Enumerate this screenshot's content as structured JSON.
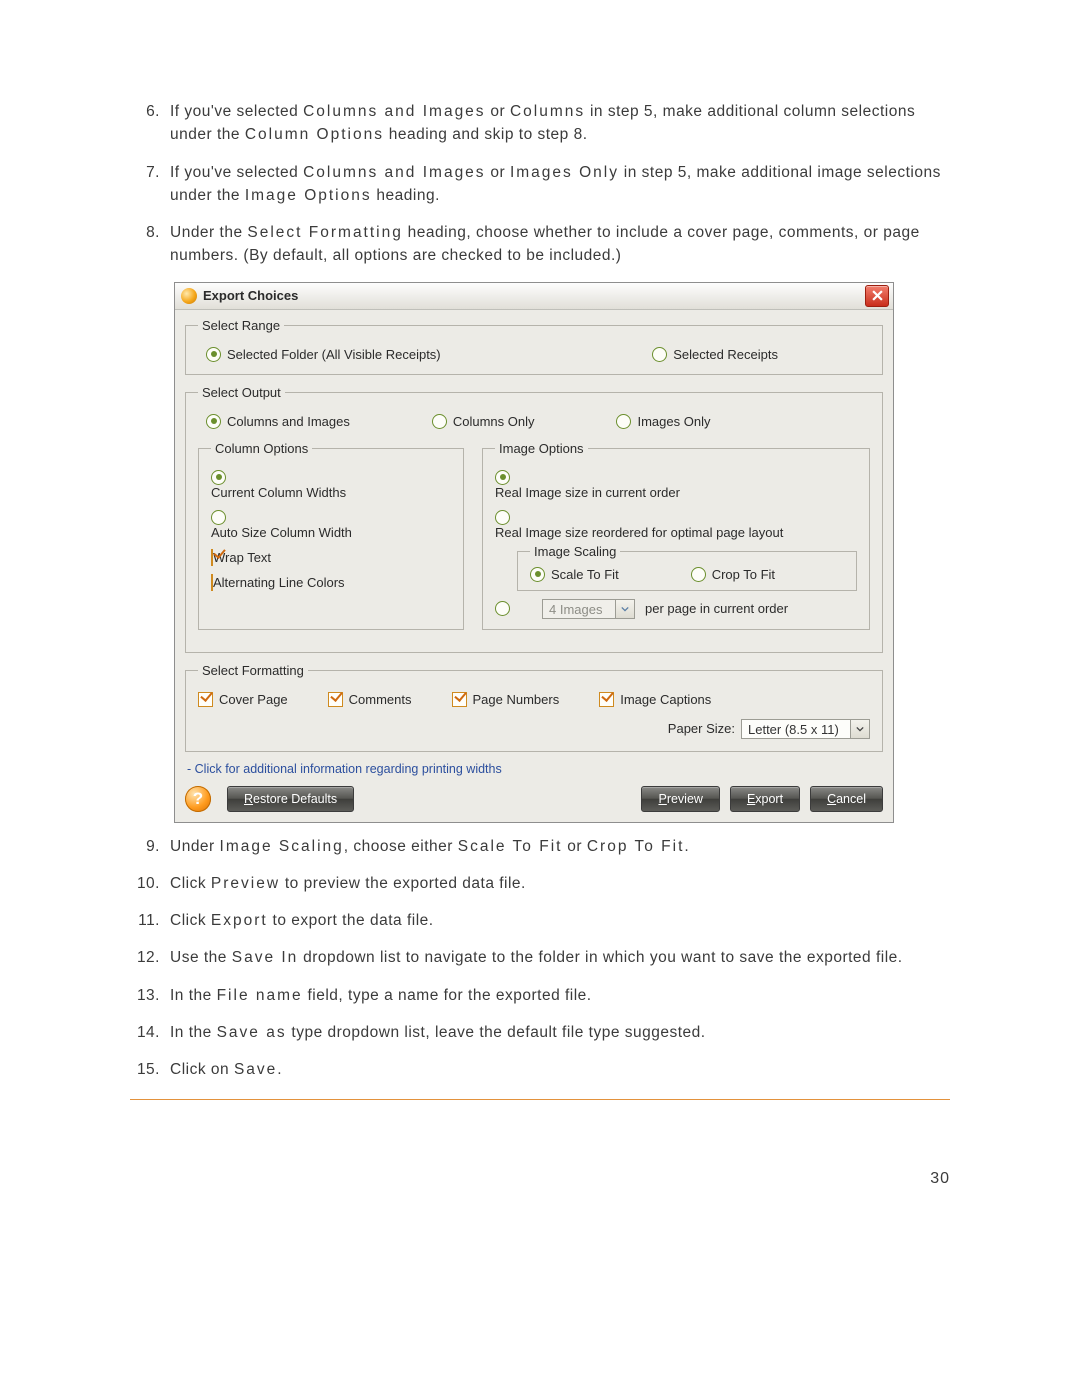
{
  "instructions": {
    "step6": {
      "n": "6.",
      "prefix": "If you've selected ",
      "b1": "Columns and Images",
      "mid": " or ",
      "b2": "Columns",
      "after": " in step 5, make additional column selections under the ",
      "b3": "Column Options",
      "tail": " heading and skip to step 8."
    },
    "step7": {
      "n": "7.",
      "prefix": "If you've selected ",
      "b1": "Columns and Images",
      "mid": " or ",
      "b2": "Images Only",
      "after": " in step 5, make additional image selections under the ",
      "b3": "Image Options",
      "tail": " heading."
    },
    "step8": {
      "n": "8.",
      "prefix": "Under the ",
      "b1": "Select Formatting",
      "after": " heading, choose whether to include a cover page, comments, or page numbers. (By default, all options are checked to be included.)"
    },
    "step9": {
      "n": "9.",
      "prefix": "Under ",
      "b1": "Image Scaling",
      "mid": ", choose either ",
      "b2": "Scale To Fit",
      "mid2": " or ",
      "b3": "Crop To Fit",
      "tail": "."
    },
    "step10": {
      "n": "10.",
      "prefix": "Click ",
      "b1": "Preview",
      "tail": " to preview the exported data file."
    },
    "step11": {
      "n": "11.",
      "prefix": "Click ",
      "b1": "Export",
      "tail": " to export the data file."
    },
    "step12": {
      "n": "12.",
      "prefix": "Use the ",
      "b1": "Save In",
      "tail": " dropdown list to navigate to the folder in which you want to save the exported file."
    },
    "step13": {
      "n": "13.",
      "prefix": "In the ",
      "b1": "File name",
      "tail": " field, type a name for the exported file."
    },
    "step14": {
      "n": "14.",
      "prefix": "In the ",
      "b1": "Save as",
      "tail": " type dropdown list, leave the default file type suggested."
    },
    "step15": {
      "n": "15.",
      "prefix": "Click on ",
      "b1": "Save",
      "tail": "."
    }
  },
  "dialog": {
    "title": "Export Choices",
    "select_range": {
      "legend": "Select Range",
      "opt_folder": "Selected Folder (All Visible Receipts)",
      "opt_receipts": "Selected Receipts"
    },
    "select_output": {
      "legend": "Select Output",
      "opt_both": "Columns and Images",
      "opt_cols": "Columns Only",
      "opt_imgs": "Images Only",
      "column_options": {
        "legend": "Column Options",
        "opt_current": "Current Column Widths",
        "opt_auto": "Auto Size Column Width",
        "chk_wrap": "Wrap Text",
        "chk_alt": "Alternating Line Colors"
      },
      "image_options": {
        "legend": "Image Options",
        "opt_real_order": "Real Image size in current order",
        "opt_real_opt": "Real Image size reordered for optimal page layout",
        "scaling": {
          "legend": "Image Scaling",
          "opt_scale": "Scale To Fit",
          "opt_crop": "Crop To Fit"
        },
        "per_page_value": "4 Images",
        "per_page_suffix": "per page in current order"
      }
    },
    "select_formatting": {
      "legend": "Select Formatting",
      "chk_cover": "Cover Page",
      "chk_comments": "Comments",
      "chk_pagenums": "Page Numbers",
      "chk_captions": "Image Captions",
      "paper_label": "Paper Size:",
      "paper_value": "Letter (8.5 x 11)"
    },
    "hint": "- Click for additional information regarding printing widths",
    "buttons": {
      "restore_u": "R",
      "restore_rest": "estore Defaults",
      "preview_u": "P",
      "preview_rest": "review",
      "export_u": "E",
      "export_rest": "xport",
      "cancel_u": "C",
      "cancel_rest": "ancel"
    }
  },
  "page_number": "30"
}
